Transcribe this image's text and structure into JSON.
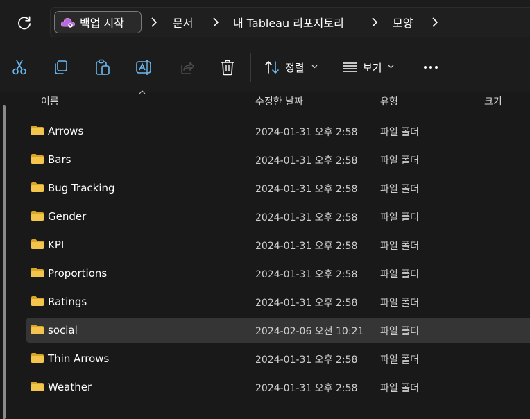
{
  "address_bar": {
    "backup_label": "백업 시작",
    "breadcrumbs": [
      "문서",
      "내 Tableau 리포지토리",
      "모양"
    ]
  },
  "toolbar": {
    "sort_label": "정렬",
    "view_label": "보기"
  },
  "columns": {
    "name": "이름",
    "modified": "수정한 날짜",
    "type": "유형",
    "size": "크기"
  },
  "rows": [
    {
      "name": "Arrows",
      "date": "2024-01-31 오후 2:58",
      "type": "파일 폴더"
    },
    {
      "name": "Bars",
      "date": "2024-01-31 오후 2:58",
      "type": "파일 폴더"
    },
    {
      "name": "Bug Tracking",
      "date": "2024-01-31 오후 2:58",
      "type": "파일 폴더"
    },
    {
      "name": "Gender",
      "date": "2024-01-31 오후 2:58",
      "type": "파일 폴더"
    },
    {
      "name": "KPI",
      "date": "2024-01-31 오후 2:58",
      "type": "파일 폴더"
    },
    {
      "name": "Proportions",
      "date": "2024-01-31 오후 2:58",
      "type": "파일 폴더"
    },
    {
      "name": "Ratings",
      "date": "2024-01-31 오후 2:58",
      "type": "파일 폴더"
    },
    {
      "name": "social",
      "date": "2024-02-06 오전 10:21",
      "type": "파일 폴더",
      "selected": true
    },
    {
      "name": "Thin Arrows",
      "date": "2024-01-31 오후 2:58",
      "type": "파일 폴더"
    },
    {
      "name": "Weather",
      "date": "2024-01-31 오후 2:58",
      "type": "파일 폴더"
    }
  ],
  "colors": {
    "folder": "#f4c54d",
    "folder_back": "#d9a628",
    "selection": "#353535"
  },
  "icons": [
    "refresh-icon",
    "cloud-backup-icon",
    "cut-icon",
    "copy-icon",
    "paste-icon",
    "rename-icon",
    "share-icon",
    "delete-icon",
    "sort-icon",
    "view-icon",
    "more-icon",
    "folder-icon"
  ]
}
